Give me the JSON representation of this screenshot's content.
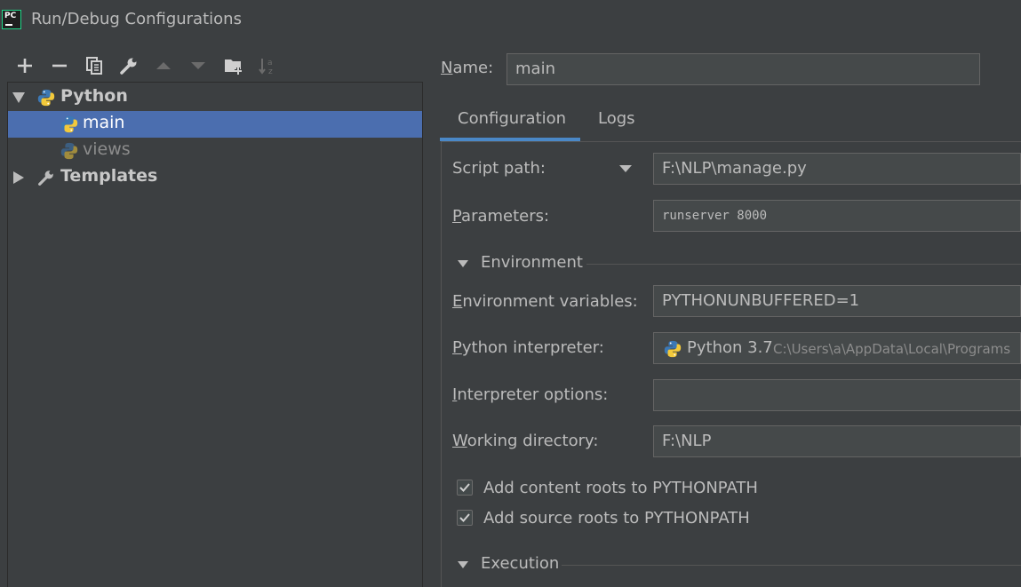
{
  "window": {
    "title": "Run/Debug Configurations",
    "app_icon_text": "PC"
  },
  "toolbar": {
    "items": [
      {
        "icon": "add-icon"
      },
      {
        "icon": "remove-icon"
      },
      {
        "icon": "copy-icon"
      },
      {
        "icon": "wrench-icon"
      },
      {
        "icon": "move-up-icon"
      },
      {
        "icon": "move-down-icon"
      },
      {
        "icon": "new-folder-icon"
      },
      {
        "icon": "sort-icon"
      }
    ]
  },
  "tree": {
    "python_group": "Python",
    "items": [
      {
        "label": "main",
        "selected": true
      },
      {
        "label": "views",
        "selected": false
      }
    ],
    "templates": "Templates"
  },
  "name": {
    "label_mnemonic": "N",
    "label_rest": "ame:",
    "value": "main"
  },
  "tabs": [
    {
      "label": "Configuration",
      "active": true
    },
    {
      "label": "Logs",
      "active": false
    }
  ],
  "form": {
    "script_path_label": "Script path:",
    "script_path_value": "F:\\NLP\\manage.py",
    "parameters_label_m": "P",
    "parameters_label_rest": "arameters:",
    "parameters_value": "runserver 8000",
    "environment_section": "Environment",
    "env_vars_label_m": "E",
    "env_vars_label_rest": "nvironment variables:",
    "env_vars_value": "PYTHONUNBUFFERED=1",
    "interpreter_label_m": "P",
    "interpreter_label_rest": "ython interpreter:",
    "interpreter_name": "Python 3.7",
    "interpreter_path": "C:\\Users\\a\\AppData\\Local\\Programs",
    "interp_options_label_m": "I",
    "interp_options_label_rest": "nterpreter options:",
    "interp_options_value": "",
    "working_dir_label_m": "W",
    "working_dir_label_rest": "orking directory:",
    "working_dir_value": "F:\\NLP",
    "add_content_roots": "Add content roots to PYTHONPATH",
    "add_content_roots_checked": true,
    "add_source_roots": "Add source roots to PYTHONPATH",
    "add_source_roots_checked": true,
    "execution_section": "Execution"
  },
  "colors": {
    "background": "#3c3f41",
    "selection": "#4b6eaf",
    "tab_accent": "#4a88c7",
    "input_bg": "#45494a",
    "text": "#bbbbbb"
  }
}
